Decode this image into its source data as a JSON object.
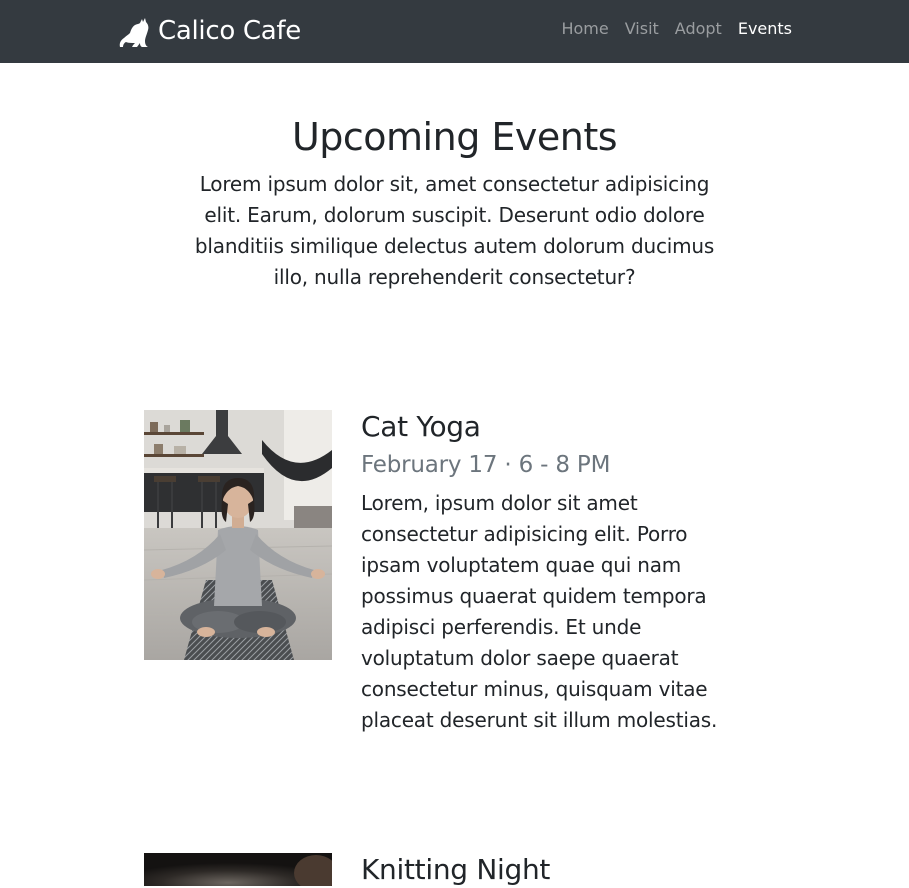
{
  "navbar": {
    "brand": "Calico Cafe",
    "brand_icon": "cat-icon",
    "links": [
      {
        "label": "Home"
      },
      {
        "label": "Visit"
      },
      {
        "label": "Adopt"
      },
      {
        "label": "Events"
      }
    ],
    "active_link": "Events",
    "colors": {
      "background": "#343a40",
      "active": "#ffffff",
      "inactive": "#9a9da0"
    }
  },
  "hero": {
    "title": "Upcoming Events",
    "lead": "Lorem ipsum dolor sit, amet consectetur adipisicing elit. Earum, dolorum suscipit. Deserunt odio dolore blanditiis similique delectus autem dolorum ducimus illo, nulla reprehenderit consectetur?"
  },
  "events": [
    {
      "title": "Cat Yoga",
      "date": "February 17 · 6 - 8 PM",
      "description": "Lorem, ipsum dolor sit amet consectetur adipisicing elit. Porro ipsam voluptatem quae qui nam possimus quaerat quidem tempora adipisci perferendis. Et unde voluptatum dolor saepe quaerat consectetur minus, quisquam vitae placeat deserunt sit illum molestias.",
      "image": "yoga-photo"
    },
    {
      "title": "Knitting Night",
      "image": "knitting-photo"
    }
  ]
}
